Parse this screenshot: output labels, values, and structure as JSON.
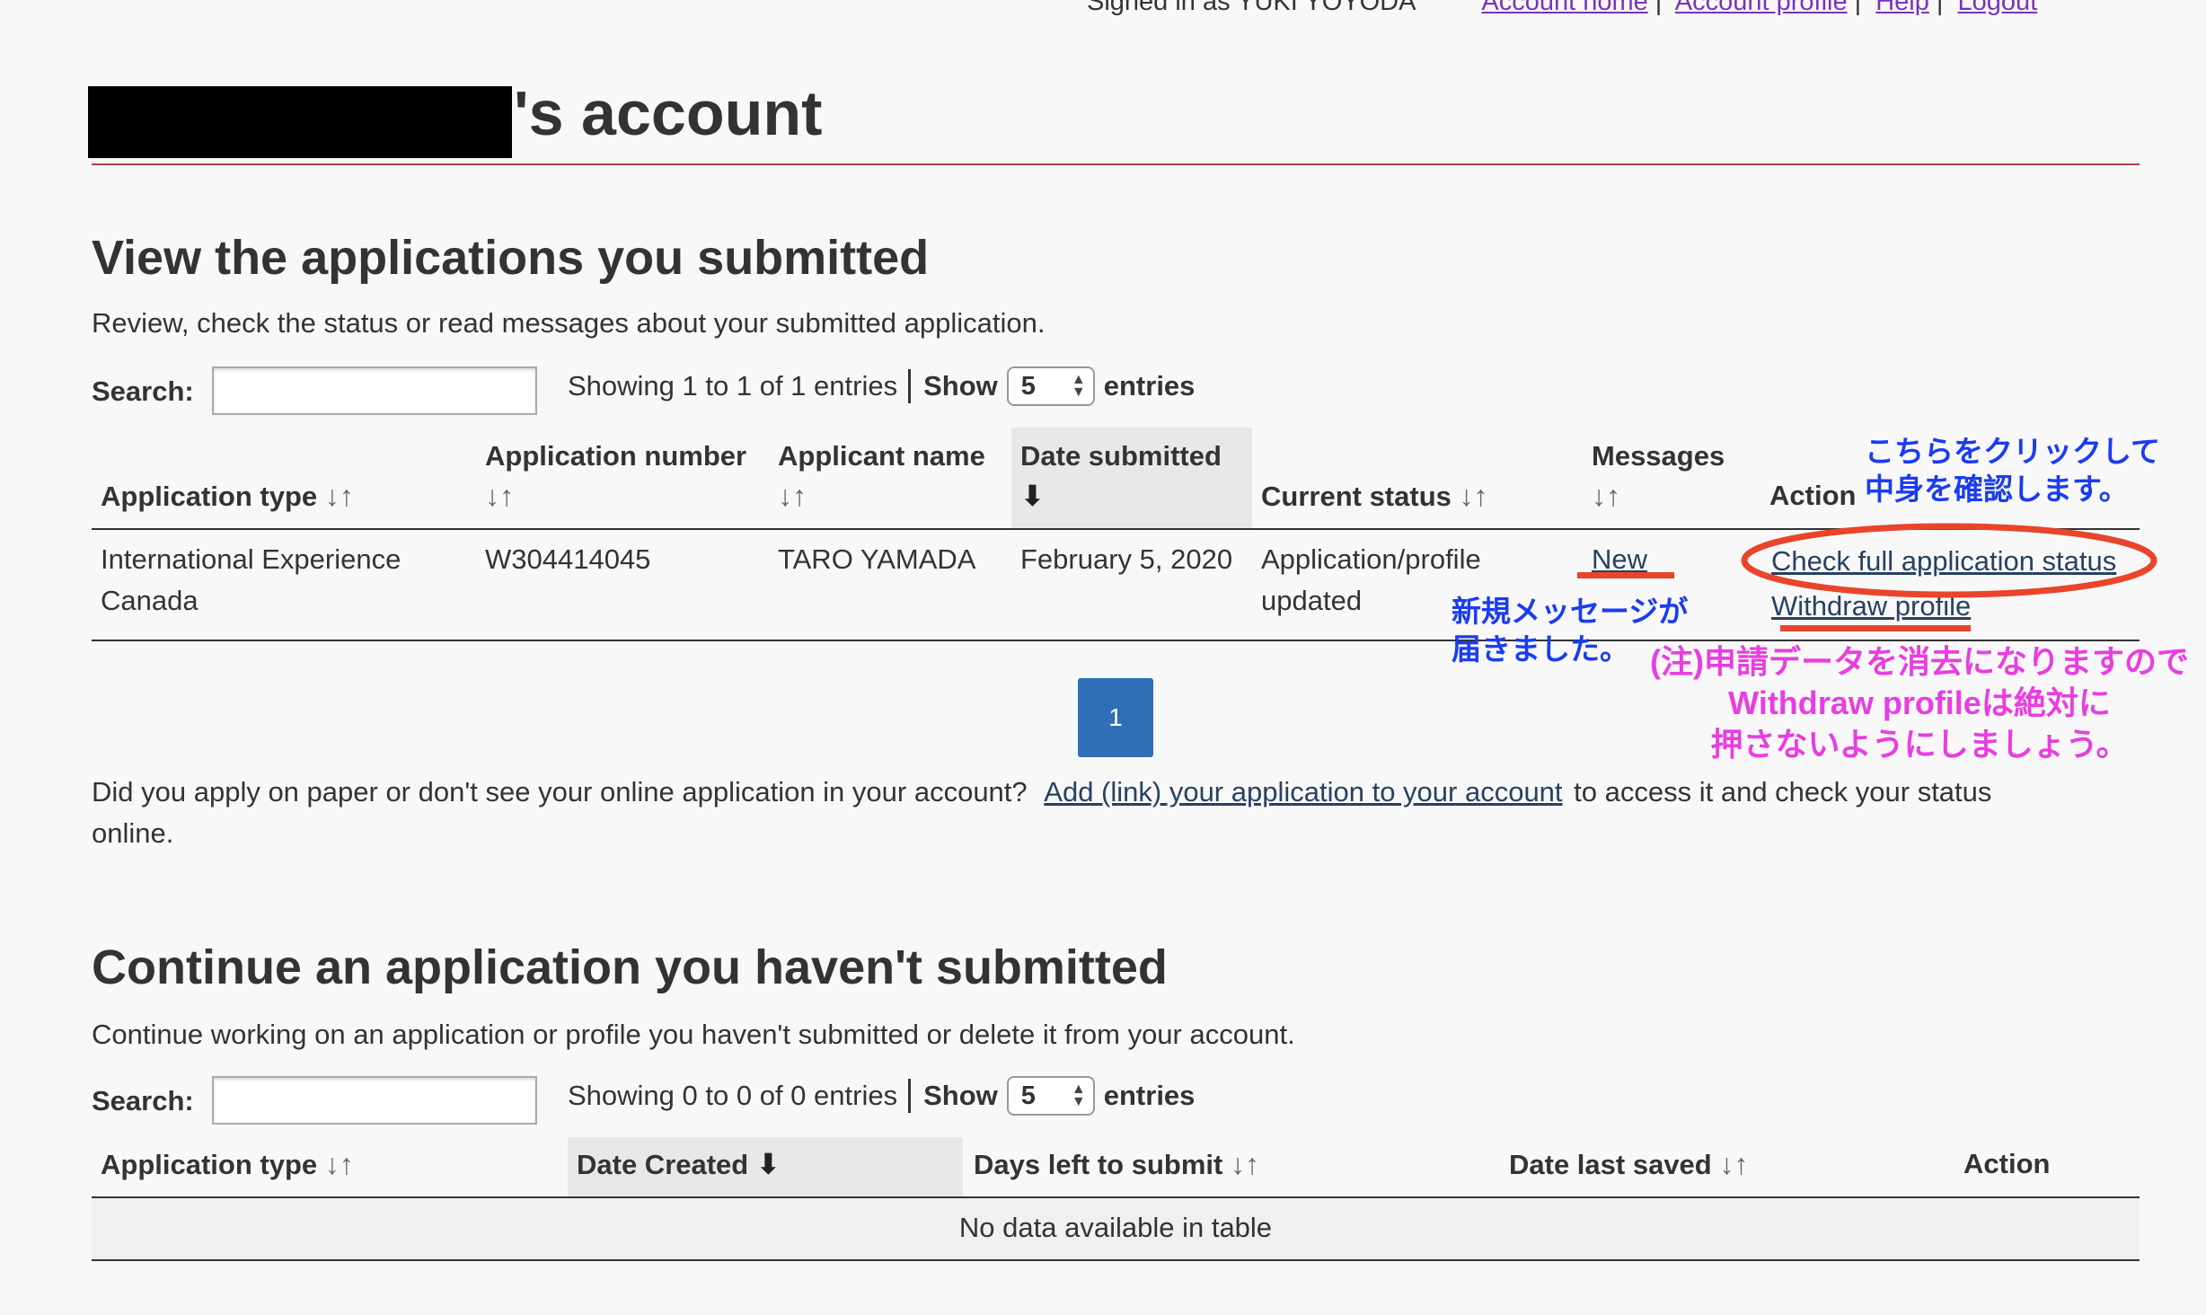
{
  "topbar": {
    "signed_in": "Signed in as YUKI YOYODA",
    "links": [
      "Account home",
      "Account profile",
      "Help",
      "Logout"
    ]
  },
  "page_title_suffix": "'s account",
  "submitted": {
    "heading": "View the applications you submitted",
    "description": "Review, check the status or read messages about your submitted application.",
    "search_label": "Search:",
    "showing": "Showing 1 to 1 of 1 entries",
    "show_label": "Show",
    "show_value": "5",
    "entries_label": "entries",
    "columns": {
      "app_type": "Application type",
      "app_number": "Application number",
      "applicant_name": "Applicant name",
      "date_submitted": "Date submitted",
      "current_status": "Current status",
      "messages": "Messages",
      "action": "Action"
    },
    "row": {
      "app_type_line1": "International Experience",
      "app_type_line2": "Canada",
      "app_number": "W304414045",
      "applicant_name": "TARO YAMADA",
      "date_submitted": "February 5, 2020",
      "status_line1": "Application/profile",
      "status_line2": "updated",
      "messages": "New",
      "action_check": "Check full application status",
      "action_withdraw": "Withdraw profile"
    },
    "page_number": "1",
    "paper_text": "Did you apply on paper or don't see your online application in your account?",
    "paper_link": "Add (link) your application to your account",
    "paper_after": "to access it and check your status",
    "paper_line2": "online."
  },
  "unsubmitted": {
    "heading": "Continue an application you haven't submitted",
    "description": "Continue working on an application or profile you haven't submitted or delete it from your account.",
    "search_label": "Search:",
    "showing": "Showing 0 to 0 of 0 entries",
    "show_label": "Show",
    "show_value": "5",
    "entries_label": "entries",
    "columns": {
      "app_type": "Application type",
      "date_created": "Date Created",
      "days_left": "Days left to submit",
      "date_last_saved": "Date last saved",
      "action": "Action"
    },
    "empty": "No data available in table"
  },
  "annotations": {
    "click_here_line1": "こちらをクリックして",
    "click_here_line2": "中身を確認します。",
    "new_msg_line1": "新規メッセージが",
    "new_msg_line2": "届きました。",
    "warn_line1": "(注)申請データを消去になりますので",
    "warn_line2": "Withdraw profileは絶対に",
    "warn_line3": "押さないようにしましょう。"
  },
  "colors": {
    "accent_red": "#e8452c",
    "annotation_blue": "#1a3cf0",
    "annotation_pink": "#e83ee0",
    "link": "#284162",
    "pager": "#2f6fb5"
  },
  "icons": {
    "sort": "sort-both-icon",
    "sorted_desc": "arrow-down-icon"
  }
}
